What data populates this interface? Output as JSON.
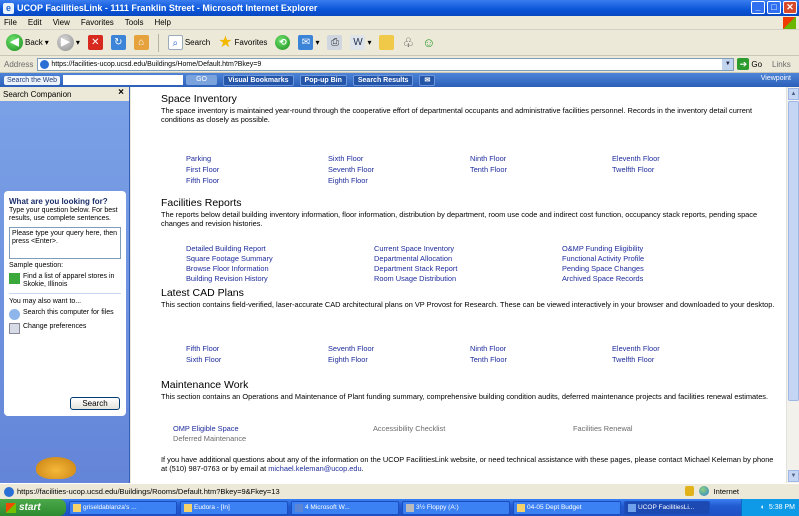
{
  "window": {
    "title": "UCOP FacilitiesLink - 1111 Franklin Street - Microsoft Internet Explorer",
    "controls": [
      "minimize",
      "maximize",
      "close"
    ]
  },
  "menu": [
    "File",
    "Edit",
    "View",
    "Favorites",
    "Tools",
    "Help"
  ],
  "toolbar": {
    "back_label": "Back",
    "search_label": "Search",
    "favorites_label": "Favorites"
  },
  "address": {
    "label": "Address",
    "url": "https://facilities-ucop.ucsd.edu/Buildings/Home/Default.htm?Bkey=9",
    "go_label": "Go",
    "links_label": "Links"
  },
  "searchbar": {
    "search_web_label": "Search the Web",
    "go_label": "GO",
    "visual_bookmarks": "Visual Bookmarks",
    "popup_bin": "Pop-up Bin",
    "search_results": "Search Results",
    "viewpoint": "Viewpoint"
  },
  "companion": {
    "title": "Search Companion",
    "question": "What are you looking for?",
    "instructions": "Type your question below. For best results, use complete sentences.",
    "placeholder": "Please type your query here, then press <Enter>.",
    "sample_label": "Sample question:",
    "sample_question": "Find a list of apparel stores in Skokie, Illinois",
    "also_label": "You may also want to...",
    "option_1": "Search this computer for files",
    "option_2": "Change preferences",
    "search_button": "Search"
  },
  "sections": {
    "space_inventory": {
      "title": "Space Inventory",
      "desc": "The space inventory is maintained year-round through the cooperative effort of departmental occupants and administrative facilities personnel. Records in the inventory detail current conditions as closely as possible.",
      "links": [
        "Parking",
        "Sixth Floor",
        "Ninth Floor",
        "Eleventh Floor",
        "First Floor",
        "Seventh Floor",
        "Tenth Floor",
        "Twelfth Floor",
        "Fifth Floor",
        "Eighth Floor"
      ]
    },
    "facilities_reports": {
      "title": "Facilities Reports",
      "desc": "The reports below detail building inventory information, floor information, distribution by department, room use code and indirect cost function, occupancy stack reports, pending space changes and revision histories.",
      "links": [
        "Detailed Building Report",
        "Current Space Inventory",
        "O&MP Funding Eligibility",
        "Square Footage Summary",
        "Departmental Allocation",
        "Functional Activity Profile",
        "Browse Floor Information",
        "Department Stack Report",
        "Pending Space Changes",
        "Building Revision History",
        "Room Usage Distribution",
        "Archived Space Records"
      ]
    },
    "cad_plans": {
      "title": "Latest CAD Plans",
      "desc": "This section contains field-verified, laser-accurate CAD architectural plans on VP Provost for Research. These can be viewed interactively in your browser and downloaded to your desktop.",
      "links": [
        "Fifth Floor",
        "Seventh Floor",
        "Ninth Floor",
        "Eleventh Floor",
        "Sixth Floor",
        "Eighth Floor",
        "Tenth Floor",
        "Twelfth Floor"
      ]
    },
    "maintenance": {
      "title": "Maintenance Work",
      "desc": "This section contains an Operations and Maintenance of Plant funding summary, comprehensive building condition audits, deferred maintenance projects and facilities renewal estimates.",
      "links": [
        "OMP Eligible Space",
        "Accessibility Checklist",
        "Facilities Renewal",
        "Deferred Maintenance"
      ]
    }
  },
  "footer": {
    "text": "If you have additional questions about any of the information on the UCOP FacilitiesLink website, or need technical assistance with these pages, please contact Michael Keleman by phone at (510) 987-0763 or by email at ",
    "email": "michael.keleman@ucop.edu",
    "end": "."
  },
  "status": {
    "url": "https://facilities-ucop.ucsd.edu/Buildings/Rooms/Default.htm?Bkey=9&Fkey=13",
    "zone": "Internet"
  },
  "taskbar": {
    "start": "start",
    "tasks": [
      "griseldablanza's ...",
      "Eudora - [In]",
      "4 Microsoft W...",
      "3½ Floppy (A:)",
      "04-05 Dept Budget",
      "UCOP FacilitiesLi..."
    ],
    "clock": "5:38 PM"
  }
}
